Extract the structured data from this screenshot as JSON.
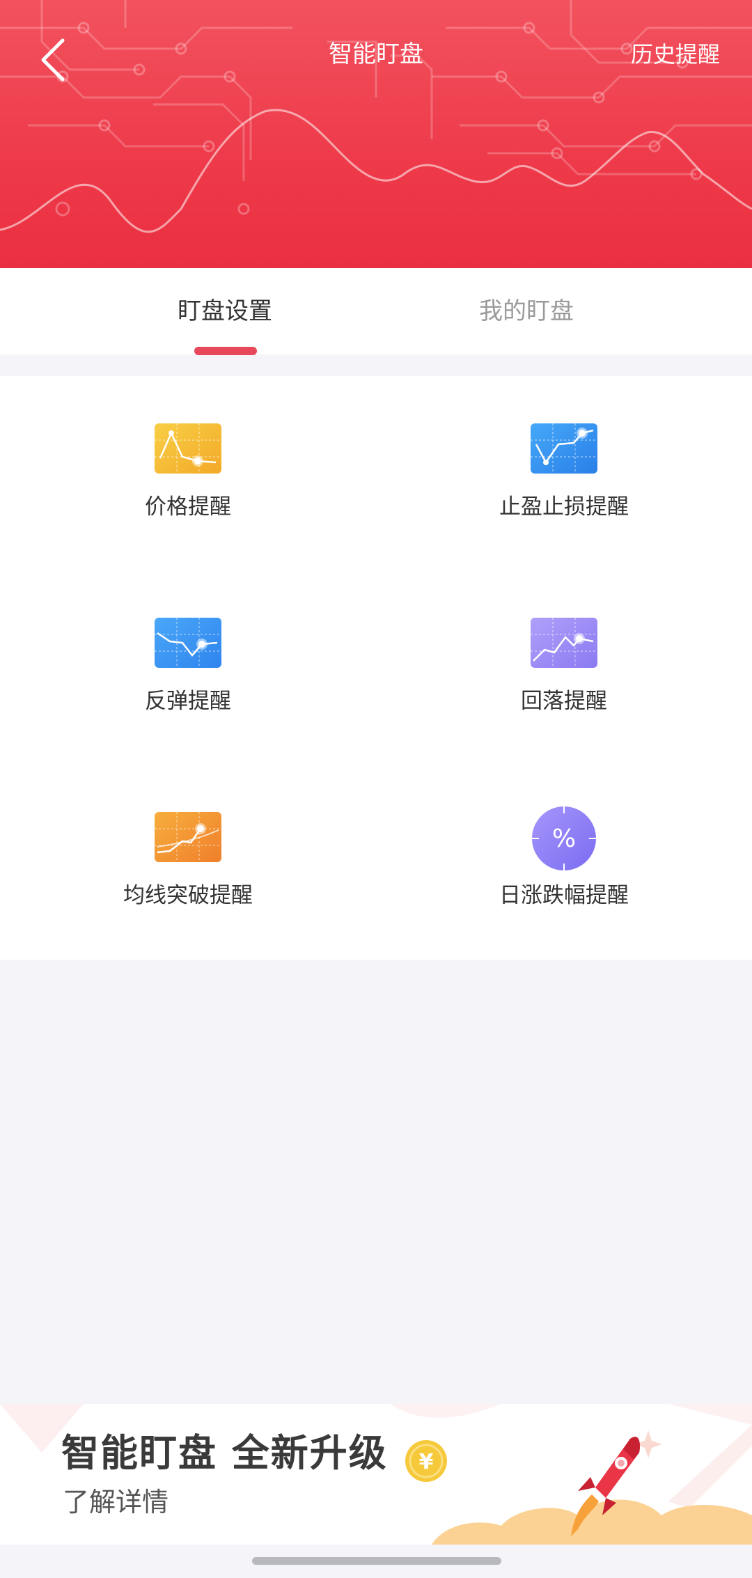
{
  "header": {
    "title": "智能盯盘",
    "history_label": "历史提醒",
    "back_icon": "chevron-left-icon",
    "background_color": "#ee3a4a"
  },
  "tabs": [
    {
      "label": "盯盘设置",
      "active": true
    },
    {
      "label": "我的盯盘",
      "active": false
    }
  ],
  "colors": {
    "accent": "#e8485a",
    "price_icon": "#f5b731",
    "stop_icon": "#2f8ef0",
    "rebound_icon": "#3a93f2",
    "fallback_icon": "#9b8cf5",
    "ma_icon": "#f29a32",
    "percent_icon": "#8a7ef6"
  },
  "features": [
    {
      "label": "价格提醒",
      "icon": "price-chart-icon"
    },
    {
      "label": "止盈止损提醒",
      "icon": "stop-profit-loss-chart-icon"
    },
    {
      "label": "反弹提醒",
      "icon": "rebound-chart-icon"
    },
    {
      "label": "回落提醒",
      "icon": "fallback-chart-icon"
    },
    {
      "label": "均线突破提醒",
      "icon": "moving-average-chart-icon"
    },
    {
      "label": "日涨跌幅提醒",
      "icon": "percent-icon"
    }
  ],
  "banner": {
    "title": "智能盯盘 全新升级",
    "subtitle": "了解详情",
    "icons": [
      "yen-coin-icon",
      "rocket-icon"
    ]
  }
}
